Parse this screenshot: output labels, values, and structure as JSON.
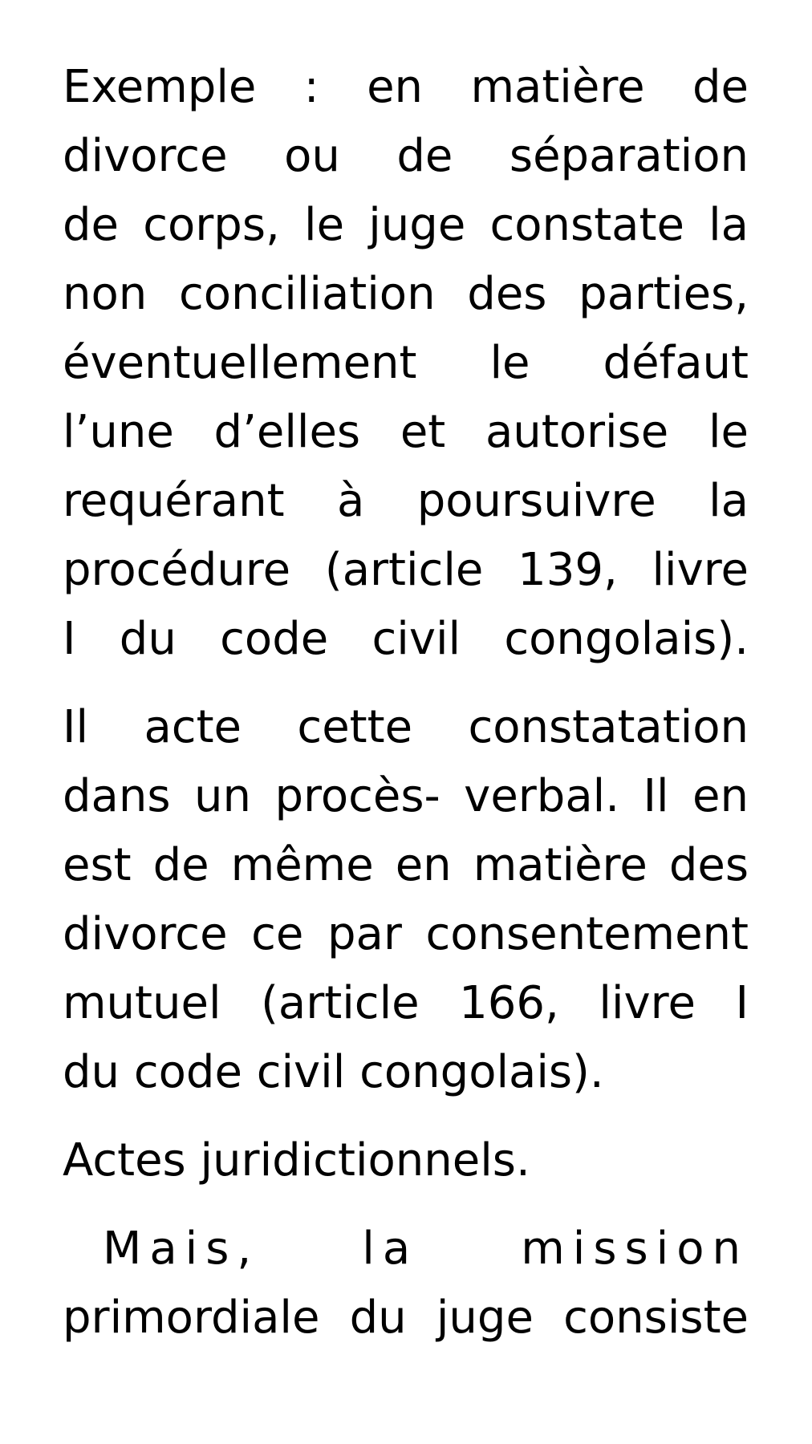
{
  "paragraphs": [
    {
      "lines": [
        "Exemple : en matière de",
        "divorce ou de séparation",
        "de corps, le juge constate la",
        "non conciliation des parties,",
        "éventuellement le défaut",
        "l’une d’elles et autorise le",
        "requérant à poursuivre la",
        "procédure (article 139, livre",
        "I du  code civil congolais)."
      ]
    },
    {
      "lines": [
        "Il acte cette constatation",
        "dans un procès- verbal. Il en",
        "est de même en matière des",
        "divorce ce par consentement",
        "mutuel (article 166, livre I",
        "du code civil congolais)."
      ]
    },
    {
      "lines": [
        "Actes juridictionnels."
      ]
    },
    {
      "lines": [
        "Mais, la mission",
        "primordiale du juge consiste"
      ]
    }
  ]
}
